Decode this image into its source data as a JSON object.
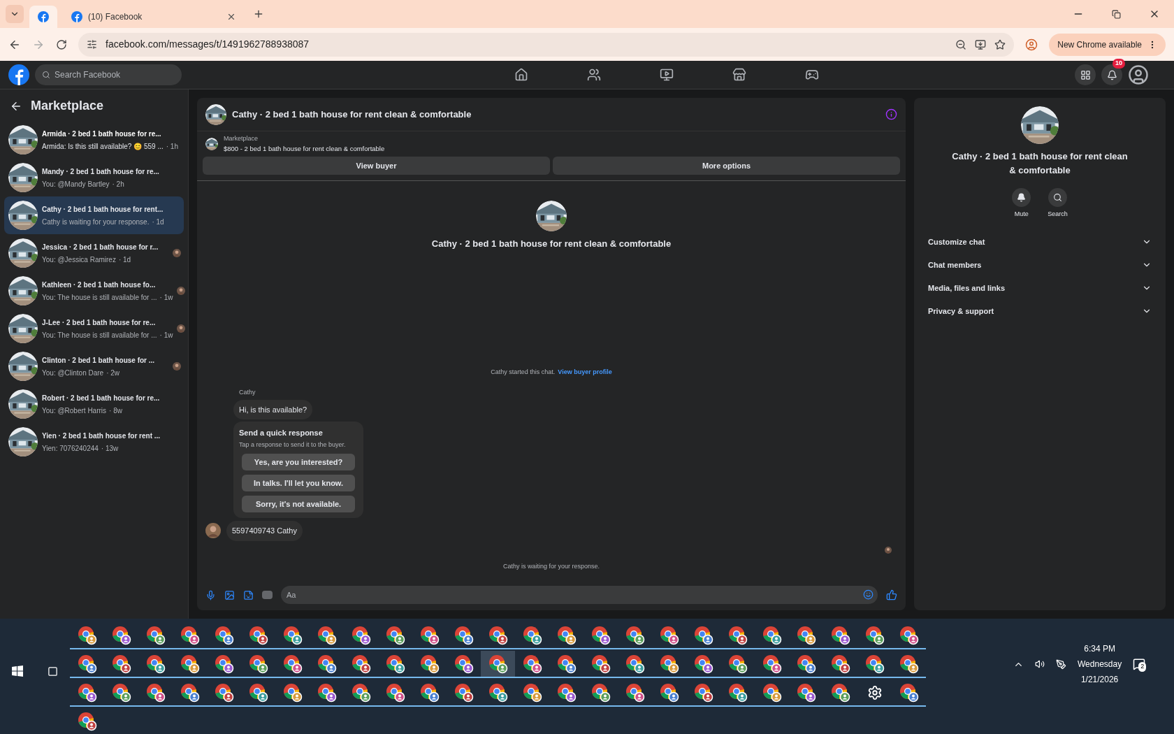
{
  "browser": {
    "tabs": [
      {
        "selected": true
      },
      {
        "label": "(10) Facebook",
        "selected": false
      }
    ],
    "url": "facebook.com/messages/t/1491962788938087",
    "update_button": "New Chrome available"
  },
  "facebook_header": {
    "search_placeholder": "Search Facebook",
    "nav": [
      {
        "kind": "home",
        "selected": false
      },
      {
        "kind": "friends",
        "selected": false
      },
      {
        "kind": "video",
        "selected": false
      },
      {
        "kind": "marketplace",
        "selected": false
      },
      {
        "kind": "gaming",
        "selected": false
      }
    ],
    "notification_count": "10"
  },
  "sidebar": {
    "title": "Marketplace",
    "items": [
      {
        "title": "Armida · 2 bed 1 bath house for re...",
        "preview": "Armida: Is this still available? 😊 559 ...",
        "time": "· 1h",
        "selected": false,
        "seen": false,
        "unread": true
      },
      {
        "title": "Mandy · 2 bed 1 bath house for re...",
        "preview": "You: @Mandy Bartley",
        "time": "· 2h",
        "selected": false,
        "seen": false,
        "unread": false
      },
      {
        "title": "Cathy · 2 bed 1 bath house for rent...",
        "preview": "Cathy is waiting for your response.",
        "time": "· 1d",
        "selected": true,
        "seen": false,
        "unread": false
      },
      {
        "title": "Jessica · 2 bed 1 bath house for r...",
        "preview": "You: @Jessica Ramirez",
        "time": "· 1d",
        "selected": false,
        "seen": true,
        "unread": false
      },
      {
        "title": "Kathleen · 2 bed 1 bath house fo...",
        "preview": "You: The house is still available for ...",
        "time": "· 1w",
        "selected": false,
        "seen": true,
        "unread": false
      },
      {
        "title": "J-Lee · 2 bed 1 bath house for re...",
        "preview": "You: The house is still available for ...",
        "time": "· 1w",
        "selected": false,
        "seen": true,
        "unread": false
      },
      {
        "title": "Clinton · 2 bed 1 bath house for ...",
        "preview": "You: @Clinton Dare",
        "time": "· 2w",
        "selected": false,
        "seen": true,
        "unread": false
      },
      {
        "title": "Robert · 2 bed 1 bath house for re...",
        "preview": "You: @Robert Harris",
        "time": "· 8w",
        "selected": false,
        "seen": false,
        "unread": false
      },
      {
        "title": "Yien · 2 bed 1 bath house for rent ...",
        "preview": "Yien: 7076240244",
        "time": "· 13w",
        "selected": false,
        "seen": false,
        "unread": false
      }
    ]
  },
  "chat": {
    "title": "Cathy · 2 bed 1 bath house for rent clean & comfortable",
    "listing_label": "Marketplace",
    "listing_title": "$800 - 2 bed 1 bath house for rent clean & comfortable",
    "buttons": [
      "View buyer",
      "More options"
    ],
    "intro_title": "Cathy · 2 bed 1 bath house for rent clean & comfortable",
    "started_text": "Cathy started this chat.",
    "started_link": "View buyer profile",
    "sender": "Cathy",
    "first_message": "Hi, is this available?",
    "quick_response": {
      "title": "Send a quick response",
      "subtitle": "Tap a response to send it to the buyer.",
      "options": [
        "Yes, are you interested?",
        "In talks. I'll let you know.",
        "Sorry, it's not available."
      ]
    },
    "second_message": "5597409743 Cathy",
    "status": "Cathy is waiting for your response.",
    "composer_placeholder": "Aa"
  },
  "details": {
    "title": "Cathy · 2 bed 1 bath house for rent clean & comfortable",
    "actions": [
      {
        "kind": "mute",
        "label": "Mute"
      },
      {
        "kind": "search",
        "label": "Search"
      }
    ],
    "sections": [
      {
        "label": "Customize chat",
        "expanded": false
      },
      {
        "label": "Chat members",
        "expanded": false
      },
      {
        "label": "Media, files and links",
        "expanded": false
      },
      {
        "label": "Privacy & support",
        "expanded": false
      }
    ]
  },
  "taskbar": {
    "buttons": [
      {
        "kind": "chrome",
        "selected": false
      },
      {
        "kind": "chrome",
        "selected": false
      },
      {
        "kind": "chrome",
        "selected": false
      },
      {
        "kind": "chrome",
        "selected": false
      },
      {
        "kind": "chrome",
        "selected": false
      },
      {
        "kind": "chrome",
        "selected": false
      },
      {
        "kind": "chrome",
        "selected": false
      },
      {
        "kind": "chrome",
        "selected": false
      },
      {
        "kind": "chrome",
        "selected": false
      },
      {
        "kind": "chrome",
        "selected": false
      },
      {
        "kind": "chrome",
        "selected": false
      },
      {
        "kind": "chrome",
        "selected": false
      },
      {
        "kind": "chrome",
        "selected": false
      },
      {
        "kind": "chrome",
        "selected": false
      },
      {
        "kind": "chrome",
        "selected": false
      },
      {
        "kind": "chrome",
        "selected": false
      },
      {
        "kind": "chrome",
        "selected": false
      },
      {
        "kind": "chrome",
        "selected": false
      },
      {
        "kind": "chrome",
        "selected": false
      },
      {
        "kind": "chrome",
        "selected": false
      },
      {
        "kind": "chrome",
        "selected": false
      },
      {
        "kind": "chrome",
        "selected": false
      },
      {
        "kind": "chrome",
        "selected": false
      },
      {
        "kind": "chrome",
        "selected": false
      },
      {
        "kind": "chrome",
        "selected": false
      },
      {
        "kind": "chrome",
        "selected": false
      },
      {
        "kind": "chrome",
        "selected": false
      },
      {
        "kind": "chrome",
        "selected": false
      },
      {
        "kind": "chrome",
        "selected": false
      },
      {
        "kind": "chrome",
        "selected": false
      },
      {
        "kind": "chrome",
        "selected": false
      },
      {
        "kind": "chrome",
        "selected": false
      },
      {
        "kind": "chrome",
        "selected": false
      },
      {
        "kind": "chrome",
        "selected": false
      },
      {
        "kind": "chrome",
        "selected": false
      },
      {
        "kind": "chrome",
        "selected": false
      },
      {
        "kind": "chrome",
        "selected": false
      },
      {
        "kind": "chrome",
        "selected": true
      },
      {
        "kind": "chrome",
        "selected": false
      },
      {
        "kind": "chrome",
        "selected": false
      },
      {
        "kind": "chrome",
        "selected": false
      },
      {
        "kind": "chrome",
        "selected": false
      },
      {
        "kind": "chrome",
        "selected": false
      },
      {
        "kind": "chrome",
        "selected": false
      },
      {
        "kind": "chrome",
        "selected": false
      },
      {
        "kind": "chrome",
        "selected": false
      },
      {
        "kind": "chrome",
        "selected": false
      },
      {
        "kind": "chrome",
        "selected": false
      },
      {
        "kind": "chrome",
        "selected": false
      },
      {
        "kind": "chrome",
        "selected": false
      },
      {
        "kind": "chrome",
        "selected": false
      },
      {
        "kind": "chrome",
        "selected": false
      },
      {
        "kind": "chrome",
        "selected": false
      },
      {
        "kind": "chrome",
        "selected": false
      },
      {
        "kind": "chrome",
        "selected": false
      },
      {
        "kind": "chrome",
        "selected": false
      },
      {
        "kind": "chrome",
        "selected": false
      },
      {
        "kind": "chrome",
        "selected": false
      },
      {
        "kind": "chrome",
        "selected": false
      },
      {
        "kind": "chrome",
        "selected": false
      },
      {
        "kind": "chrome",
        "selected": false
      },
      {
        "kind": "chrome",
        "selected": false
      },
      {
        "kind": "chrome",
        "selected": false
      },
      {
        "kind": "chrome",
        "selected": false
      },
      {
        "kind": "chrome",
        "selected": false
      },
      {
        "kind": "chrome",
        "selected": false
      },
      {
        "kind": "chrome",
        "selected": false
      },
      {
        "kind": "chrome",
        "selected": false
      },
      {
        "kind": "chrome",
        "selected": false
      },
      {
        "kind": "chrome",
        "selected": false
      },
      {
        "kind": "chrome",
        "selected": false
      },
      {
        "kind": "chrome",
        "selected": false
      },
      {
        "kind": "chrome",
        "selected": false
      },
      {
        "kind": "settings",
        "selected": false
      },
      {
        "kind": "chrome",
        "selected": false
      },
      {
        "kind": "chrome",
        "selected": false
      }
    ],
    "time": "6:34 PM",
    "day": "Wednesday",
    "date": "1/21/2026",
    "notifications": "2"
  }
}
